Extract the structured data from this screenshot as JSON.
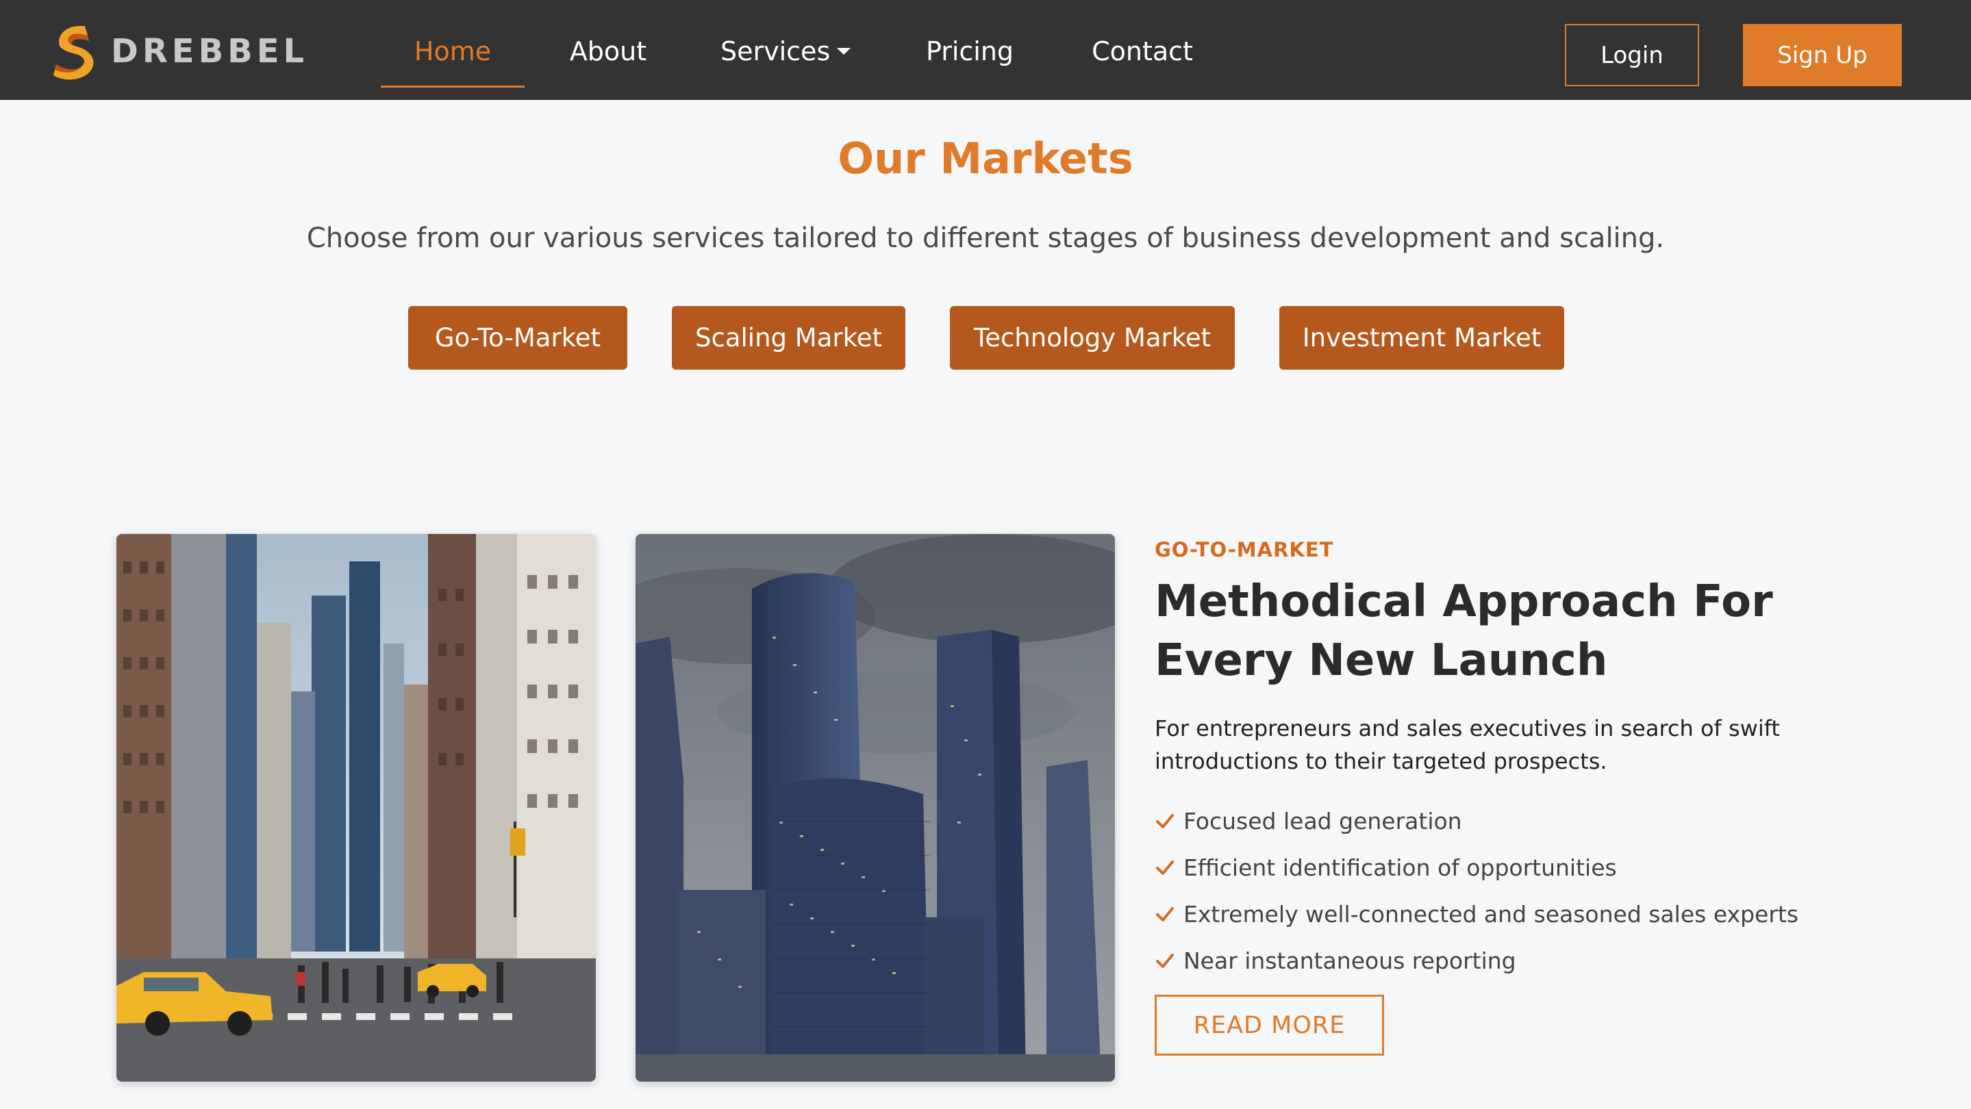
{
  "brand": {
    "name": "DREBBEL",
    "logo_icon": "drebbel-s-logo-icon"
  },
  "nav": {
    "items": [
      {
        "label": "Home",
        "active": true
      },
      {
        "label": "About"
      },
      {
        "label": "Services",
        "has_dropdown": true
      },
      {
        "label": "Pricing"
      },
      {
        "label": "Contact"
      }
    ],
    "login_label": "Login",
    "signup_label": "Sign Up"
  },
  "markets": {
    "title": "Our Markets",
    "subtitle": "Choose from our various services tailored to different stages of business development and scaling.",
    "buttons": [
      {
        "label": "Go-To-Market"
      },
      {
        "label": "Scaling Market"
      },
      {
        "label": "Technology Market"
      },
      {
        "label": "Investment Market"
      }
    ]
  },
  "feature": {
    "eyebrow": "GO-TO-MARKET",
    "title": "Methodical Approach For Every New Launch",
    "description": "For entrepreneurs and sales executives in search of swift introductions to their targeted prospects.",
    "bullets": [
      {
        "text": "Focused lead generation"
      },
      {
        "text": "Efficient identification of opportunities"
      },
      {
        "text": "Extremely well-connected and seasoned sales experts"
      },
      {
        "text": "Near instantaneous reporting"
      }
    ],
    "cta_label": "READ MORE",
    "images": [
      {
        "icon": "city-street-photo"
      },
      {
        "icon": "skyscrapers-photo"
      }
    ]
  },
  "colors": {
    "navbar_bg": "#333333",
    "accent": "#e07b2a",
    "market_button_bg": "#b5581e",
    "page_bg": "#f5f7f9",
    "heading_text": "#2b2b2b"
  }
}
